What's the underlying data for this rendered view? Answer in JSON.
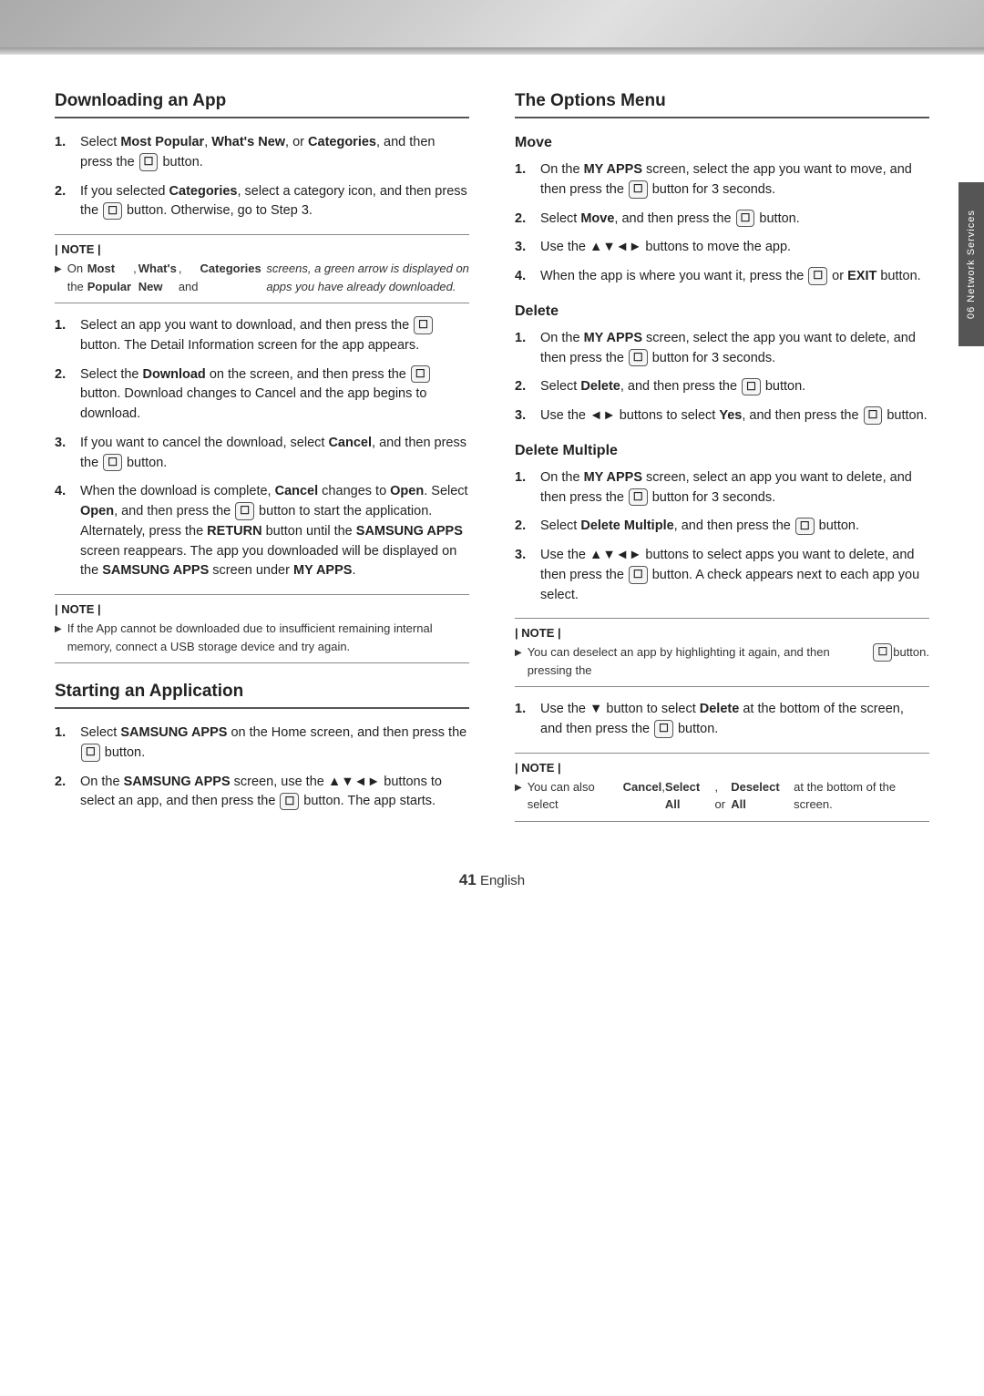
{
  "topBar": {},
  "sideTab": {
    "label": "06   Network Services"
  },
  "leftCol": {
    "section1": {
      "title": "Downloading an App",
      "steps": [
        {
          "text": "Select <b>Most Popular</b>, <b>What's New</b>, or <b>Categories</b>, and then press the <btn/> button."
        },
        {
          "text": "If you selected <b>Categories</b>, select a category icon, and then press the <btn/> button. Otherwise, go to Step 3."
        },
        {
          "text": "Select an app you want to download, and then press the <btn/> button. The Detail Information screen for the app appears."
        },
        {
          "text": "Select the <b>Download</b> on the screen, and then press the <btn/> button. Download changes to Cancel and the app begins to download."
        },
        {
          "text": "If you want to cancel the download, select <b>Cancel</b>, and then press the <btn/> button."
        },
        {
          "text": "When the download is complete, <b>Cancel</b> changes to <b>Open</b>. Select <b>Open</b>, and then press the <btn/> button to start the application. Alternately, press the <b>RETURN</b> button until the <b>SAMSUNG APPS</b> screen reappears. The app you downloaded will be displayed on the <b>SAMSUNG APPS</b> screen under <b>MY APPS</b>."
        }
      ],
      "note1": {
        "label": "| NOTE |",
        "items": [
          "On the <b>Most Popular</b>, <b>What's New</b>, and <b>Categories</b> <i>screens, a green arrow is displayed on apps you have already downloaded.</i>"
        ]
      },
      "note2": {
        "label": "| NOTE |",
        "items": [
          "If the App cannot be downloaded due to insufficient remaining internal memory, connect a USB storage device and try again."
        ]
      }
    },
    "section2": {
      "title": "Starting an Application",
      "steps": [
        {
          "text": "Select <b>SAMSUNG APPS</b> on the Home screen, and then press the <btn/> button."
        },
        {
          "text": "On the <b>SAMSUNG APPS</b> screen, use the ▲▼◄► buttons to select an app, and then press the <btn/> button. The app starts."
        }
      ]
    }
  },
  "rightCol": {
    "section1": {
      "title": "The Options Menu",
      "subsections": [
        {
          "title": "Move",
          "steps": [
            {
              "text": "On the <b>MY APPS</b> screen, select the app you want to move, and then press the <btn/> button for 3 seconds."
            },
            {
              "text": "Select <b>Move</b>, and then press the <btn/> button."
            },
            {
              "text": "Use the ▲▼◄► buttons to move the app."
            },
            {
              "text": "When the app is where you want it, press the <btn/> or <b>EXIT</b> button."
            }
          ]
        },
        {
          "title": "Delete",
          "steps": [
            {
              "text": "On the <b>MY APPS</b> screen, select the app you want to delete, and then press the <btn/> button for 3 seconds."
            },
            {
              "text": "Select <b>Delete</b>, and then press the <btn/> button."
            },
            {
              "text": "Use the ◄► buttons to select <b>Yes</b>, and then press the <btn/> button."
            }
          ]
        },
        {
          "title": "Delete Multiple",
          "steps": [
            {
              "text": "On the <b>MY APPS</b> screen, select an app you want to delete, and then press the <btn/> button for 3 seconds."
            },
            {
              "text": "Select <b>Delete Multiple</b>, and then press the <btn/> button."
            },
            {
              "text": "Use the ▲▼◄► buttons to select apps you want to delete, and then press the <btn/> button. A check appears next to each app you select."
            }
          ],
          "note1": {
            "label": "| NOTE |",
            "items": [
              "You can deselect an app by highlighting it again, and then pressing the <btn/> button."
            ]
          },
          "step4": {
            "text": "Use the ▼ button to select <b>Delete</b> at the bottom of the screen, and then press the <btn/> button."
          },
          "note2": {
            "label": "| NOTE |",
            "items": [
              "You can also select <b>Cancel</b>, <b>Select All</b>, or <b>Deselect All</b> at the bottom of the screen."
            ]
          }
        }
      ]
    }
  },
  "footer": {
    "pageNum": "41",
    "lang": "English"
  }
}
